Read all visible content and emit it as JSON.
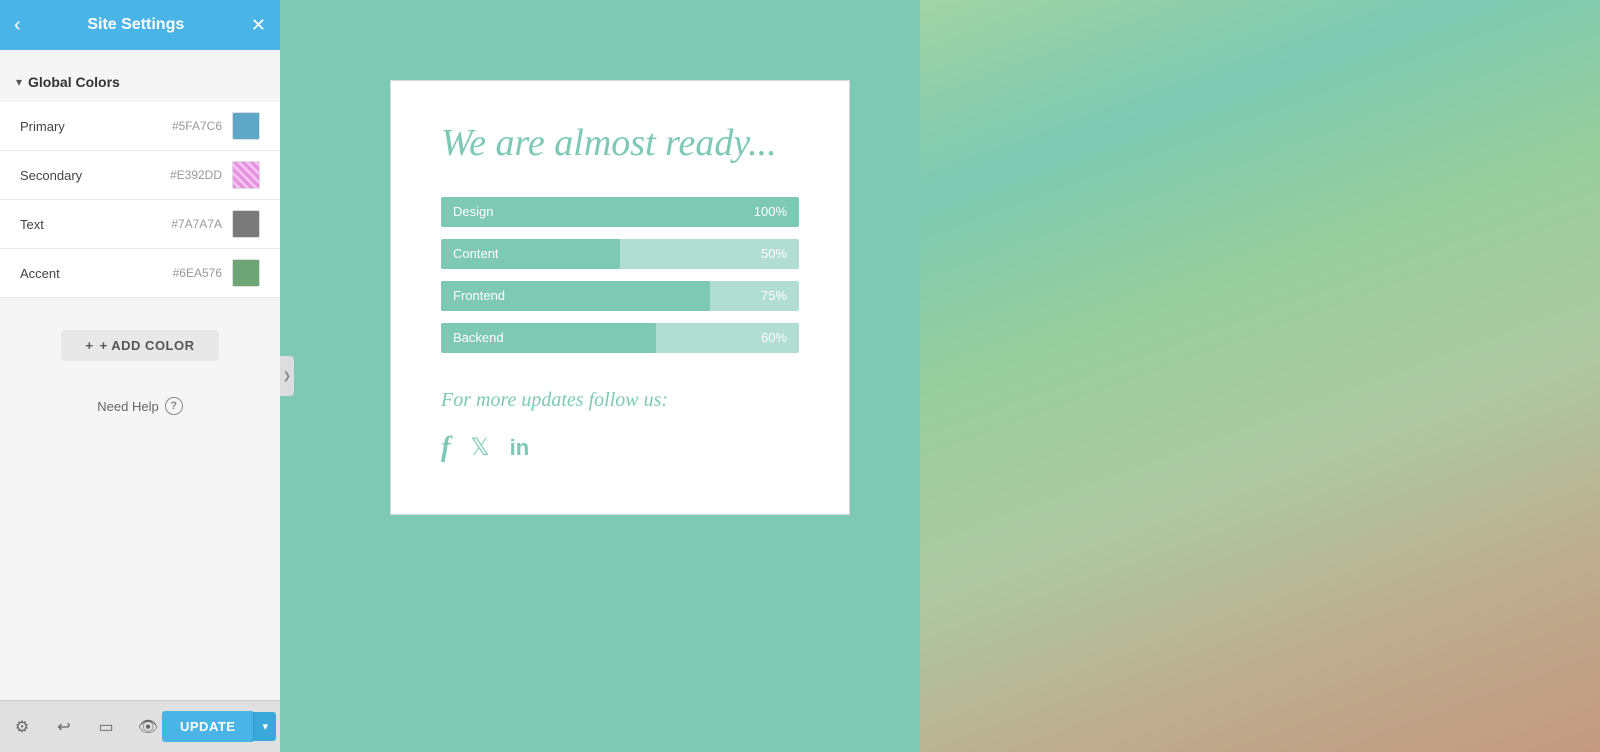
{
  "sidebar": {
    "header": {
      "title": "Site Settings",
      "back_label": "‹",
      "close_label": "✕"
    },
    "global_colors_section": {
      "label": "Global Colors",
      "chevron": "▾",
      "colors": [
        {
          "id": "primary",
          "label": "Primary",
          "hex": "#5FA7C6",
          "swatch": "#5FA7C6"
        },
        {
          "id": "secondary",
          "label": "Secondary",
          "hex": "#E392DD",
          "swatch": "#E392DD"
        },
        {
          "id": "text",
          "label": "Text",
          "hex": "#7A7A7A",
          "swatch": "#7A7A7A"
        },
        {
          "id": "accent",
          "label": "Accent",
          "hex": "#6EA576",
          "swatch": "#6EA576"
        }
      ]
    },
    "add_color_button": "+ ADD COLOR",
    "need_help_label": "Need Help",
    "help_icon": "?",
    "collapse_icon": "❯"
  },
  "footer": {
    "update_label": "UPDATE",
    "update_dropdown_icon": "▾",
    "icons": [
      {
        "id": "settings",
        "symbol": "⚙"
      },
      {
        "id": "history",
        "symbol": "↩"
      },
      {
        "id": "device",
        "symbol": "▭"
      },
      {
        "id": "preview",
        "symbol": "👁"
      }
    ]
  },
  "page": {
    "card": {
      "title": "We are almost ready...",
      "progress_items": [
        {
          "label": "Design",
          "pct": 100,
          "display": "100%"
        },
        {
          "label": "Content",
          "pct": 50,
          "display": "50%"
        },
        {
          "label": "Frontend",
          "pct": 75,
          "display": "75%"
        },
        {
          "label": "Backend",
          "pct": 60,
          "display": "60%"
        }
      ],
      "footer_text": "For more updates follow us:",
      "social_icons": [
        {
          "id": "facebook",
          "symbol": "f"
        },
        {
          "id": "twitter",
          "symbol": "🐦"
        },
        {
          "id": "linkedin",
          "symbol": "in"
        }
      ]
    }
  }
}
